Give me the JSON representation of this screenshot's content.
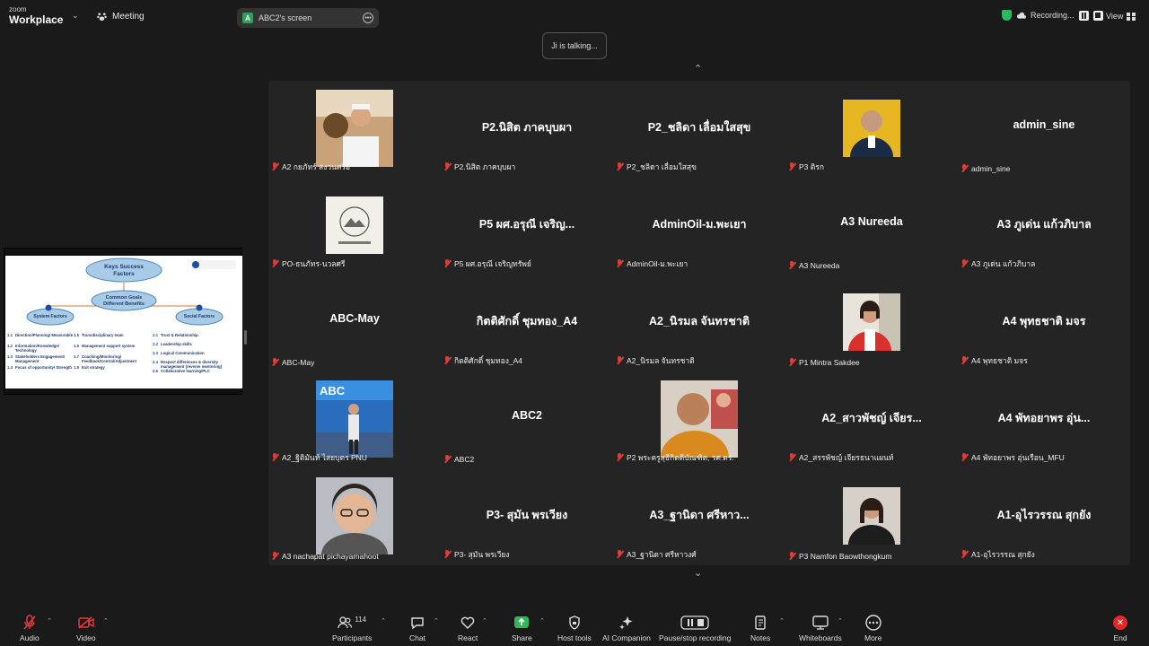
{
  "app": {
    "brand_small": "zoom",
    "brand": "Workplace",
    "meeting": "Meeting"
  },
  "share_pill": {
    "avatar": "A",
    "label": "ABC2's screen"
  },
  "recording": {
    "label": "Recording..."
  },
  "view": {
    "label": "View"
  },
  "talking": "Ji is talking...",
  "slide": {
    "title": "Keys Success Factors",
    "center": "Common Goals Different Benefits",
    "left_head": "System Factors",
    "right_head": "Social Factors",
    "left_items": [
      "Direction/Planning/ Measurable",
      "Information/Knowledge/ Technology",
      "Stakeholders Engagement/ Management",
      "Focus of opportunity/ Strength"
    ],
    "left_nums": [
      "1.1",
      "1.2",
      "1.3",
      "1.4"
    ],
    "mid_items": [
      "Transdisciplinary team",
      "Management support system",
      "Coaching/Monitoring/ Feedback/Control/Adjustment",
      "Exit strategy"
    ],
    "mid_nums": [
      "1.5",
      "1.6",
      "1.7",
      "1.8"
    ],
    "right_items": [
      "Trust & Relationship",
      "Leadership skills",
      "Logical Communication",
      "Respect differences & diversity management (reverse mentoring)",
      "Collaborative learning/PLC"
    ],
    "right_nums": [
      "2.1",
      "2.2",
      "2.3",
      "2.4",
      "2.5"
    ]
  },
  "tiles": [
    {
      "big": "",
      "name": "A2 กยภัทร์ สงวนศรีอ",
      "photo": "officer"
    },
    {
      "big": "P2.นิสิต ภาคบุบผา",
      "name": "P2.นิสิต ภาคบุบผา"
    },
    {
      "big": "P2_ชลิดา เลื่อมใสสุข",
      "name": "P2_ชลิดา เลื่อมใสสุข"
    },
    {
      "big": "",
      "name": "P3 ติรก",
      "photo": "man-yellow"
    },
    {
      "big": "admin_sine",
      "name": "admin_sine"
    },
    {
      "big": "",
      "name": "PO-ธนภัทร-นวลศรี",
      "photo": "logo"
    },
    {
      "big": "P5 ผศ.อรุณี เจริญ...",
      "name": "P5 ผศ.อรุณี เจริญทรัพย์"
    },
    {
      "big": "AdminOil-ม.พะเยา",
      "name": "AdminOil-ม.พะเยา"
    },
    {
      "big": "A3 Nureeda",
      "name": "A3 Nureeda"
    },
    {
      "big": "A3 ภูเด่น แก้วภิบาล",
      "name": "A3 ภูเด่น แก้วภิบาล"
    },
    {
      "big": "ABC-May",
      "name": "ABC-May"
    },
    {
      "big": "กิตติศักดิ์ ชุมทอง_A4",
      "name": "กิตติศักดิ์ ชุมทอง_A4"
    },
    {
      "big": "A2_นิรมล จันทรชาติ",
      "name": "A2_นิรมล จันทรชาติ"
    },
    {
      "big": "",
      "name": "P1 Mintra Sakdee",
      "photo": "woman-red"
    },
    {
      "big": "A4 พุทธชาติ มจร",
      "name": "A4 พุทธชาติ มจร"
    },
    {
      "big": "",
      "name": "A2_ฐิติมันท์ ไสยบุตร PNU",
      "photo": "banner"
    },
    {
      "big": "ABC2",
      "name": "ABC2"
    },
    {
      "big": "",
      "name": "P2 พระครูสุธีกิตติบัณฑิต, รศ.ดร.",
      "photo": "monk"
    },
    {
      "big": "A2_สาวพัชญ์ เจียร...",
      "name": "A2_สรรพัชญ์ เจียรธนาแผนท์"
    },
    {
      "big": "A4 พัทอยาพร อุ่น...",
      "name": "A4 พัทอยาพร อุ่นเรือน_MFU"
    },
    {
      "big": "",
      "name": "A3 nachapat pichayamahoot",
      "photo": "woman-glasses"
    },
    {
      "big": "P3- สุมัน พรเวียง",
      "name": "P3- สุมัน พรเวียง"
    },
    {
      "big": "A3_ฐานิดา ศรีหาว...",
      "name": "A3_ฐานิดา ศรีหาวงศ์"
    },
    {
      "big": "",
      "name": "P3 Namfon Baowthongkum",
      "photo": "woman-dark"
    },
    {
      "big": "A1-อุไรวรรณ สุกยัง",
      "name": "A1-อุไรวรรณ สุกยัง"
    }
  ],
  "toolbar": {
    "audio": "Audio",
    "video": "Video",
    "participants": "Participants",
    "participants_count": "114",
    "chat": "Chat",
    "react": "React",
    "share": "Share",
    "host_tools": "Host tools",
    "ai": "AI Companion",
    "pause_rec": "Pause/stop recording",
    "notes": "Notes",
    "whiteboards": "Whiteboards",
    "more": "More",
    "end": "End"
  },
  "colors": {
    "accent_green": "#2e9e5b",
    "mic_muted": "#e03b3b",
    "end_red": "#e02828",
    "share_green": "#2eb85c"
  }
}
